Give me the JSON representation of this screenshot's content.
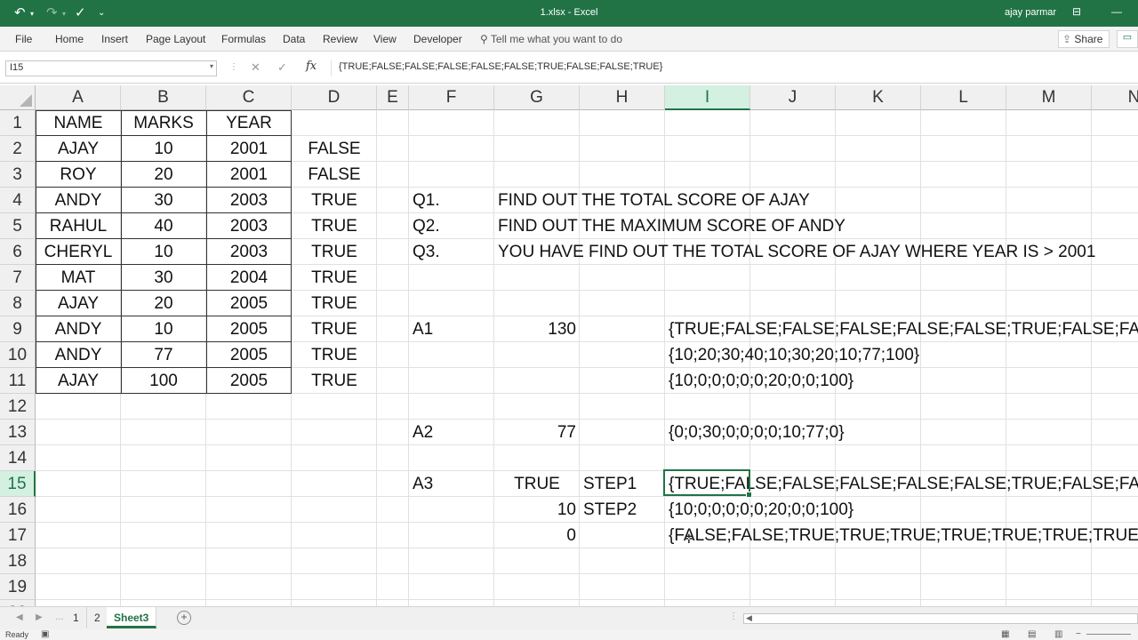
{
  "titlebar": {
    "title": "1.xlsx - Excel",
    "user": "ajay parmar",
    "icons": [
      "undo-icon",
      "redo-icon",
      "check-icon",
      "customize-qat-icon",
      "ribbon-display-icon"
    ]
  },
  "ribbon": {
    "tabs": [
      "File",
      "Home",
      "Insert",
      "Page Layout",
      "Formulas",
      "Data",
      "Review",
      "View",
      "Developer"
    ],
    "tell_me": "Tell me what you want to do",
    "share": "Share"
  },
  "formula_bar": {
    "name_box": "I15",
    "fx": "fx",
    "formula": "{TRUE;FALSE;FALSE;FALSE;FALSE;FALSE;TRUE;FALSE;FALSE;TRUE}"
  },
  "grid": {
    "columns": [
      "A",
      "B",
      "C",
      "D",
      "E",
      "F",
      "G",
      "H",
      "I",
      "J",
      "K",
      "L",
      "M",
      "N"
    ],
    "rows": [
      "1",
      "2",
      "3",
      "4",
      "5",
      "6",
      "7",
      "8",
      "9",
      "10",
      "11",
      "12",
      "13",
      "14",
      "15",
      "16",
      "17",
      "18",
      "19",
      "20"
    ],
    "selected_column": "I",
    "selected_row": "15",
    "table": {
      "headers": [
        "NAME",
        "MARKS",
        "YEAR"
      ],
      "rows": [
        [
          "AJAY",
          "10",
          "2001"
        ],
        [
          "ROY",
          "20",
          "2001"
        ],
        [
          "ANDY",
          "30",
          "2003"
        ],
        [
          "RAHUL",
          "40",
          "2003"
        ],
        [
          "CHERYL",
          "10",
          "2003"
        ],
        [
          "MAT",
          "30",
          "2004"
        ],
        [
          "AJAY",
          "20",
          "2005"
        ],
        [
          "ANDY",
          "10",
          "2005"
        ],
        [
          "ANDY",
          "77",
          "2005"
        ],
        [
          "AJAY",
          "100",
          "2005"
        ]
      ]
    },
    "col_d": [
      "FALSE",
      "FALSE",
      "TRUE",
      "TRUE",
      "TRUE",
      "TRUE",
      "TRUE",
      "TRUE",
      "TRUE",
      "TRUE"
    ],
    "questions": [
      {
        "label": "Q1.",
        "text": "FIND OUT THE TOTAL SCORE OF AJAY"
      },
      {
        "label": "Q2.",
        "text": "FIND OUT THE MAXIMUM SCORE OF ANDY"
      },
      {
        "label": "Q3.",
        "text": "YOU HAVE FIND OUT THE TOTAL SCORE OF AJAY WHERE YEAR IS > 2001"
      }
    ],
    "a1": {
      "label": "A1",
      "value": "130",
      "i9": "{TRUE;FALSE;FALSE;FALSE;FALSE;FALSE;TRUE;FALSE;FALSE;TRUE}",
      "i10": "{10;20;30;40;10;30;20;10;77;100}",
      "i11": "{10;0;0;0;0;0;20;0;0;100}"
    },
    "a2": {
      "label": "A2",
      "value": "77",
      "i13": "{0;0;30;0;0;0;0;10;77;0}"
    },
    "a3": {
      "label": "A3",
      "g15": "TRUE",
      "h15": "STEP1",
      "i15": "{TRUE;FALSE;FALSE;FALSE;FALSE;FALSE;TRUE;FALSE;FALSE;TRUE}",
      "g16": "10",
      "h16": "STEP2",
      "i16": "{10;0;0;0;0;0;20;0;0;100}",
      "g17": "0",
      "i17": "{FALSE;FALSE;TRUE;TRUE;TRUE;TRUE;TRUE;TRUE;TRUE;TRUE}"
    }
  },
  "sheet_tabs": {
    "tabs": [
      "1",
      "2",
      "Sheet3"
    ],
    "active": "Sheet3"
  },
  "status": {
    "ready": "Ready"
  }
}
